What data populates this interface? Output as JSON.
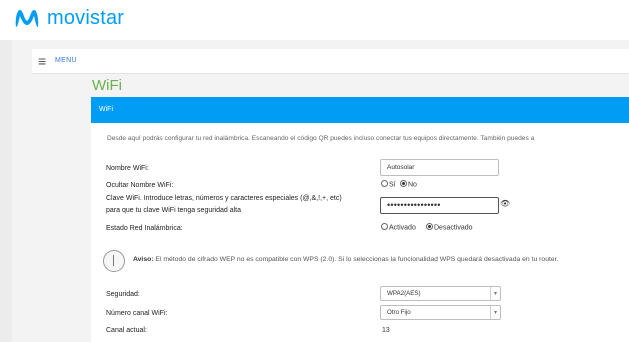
{
  "brand": {
    "name": "movistar",
    "color": "#019df4"
  },
  "menu": {
    "label": "MENU"
  },
  "page": {
    "title": "WiFi"
  },
  "panel": {
    "header": "WiFi",
    "description": "Desde aquí podrás configurar tu red inalámbrica. Escaneando el código QR puedes incluso conectar tus equipos directamente. También puedes a"
  },
  "form": {
    "network_name": {
      "label": "Nombre WiFi:",
      "value": "Autosolar"
    },
    "hide_name": {
      "label": "Ocultar Nombre WiFi:",
      "options": [
        "Sí",
        "No"
      ],
      "selected": "No"
    },
    "password": {
      "label": "Clave WiFi. Introduce letras, números y caracteres especiales (@,&,!,+, etc) para que tu clave WiFi tenga seguridad alta",
      "value": "••••••••••••••••"
    },
    "wireless_state": {
      "label": "Estado Red Inalámbrica:",
      "options": [
        "Activado",
        "Desactivado"
      ],
      "selected": "Desactivado"
    }
  },
  "warning": {
    "title": "Aviso:",
    "text": " El método de cifrado WEP no es compatible con WPS (2.0). Si lo seleccionas la funcionalidad WPS quedará desactivada en tu router."
  },
  "security": {
    "label": "Seguridad:",
    "value": "WPA2(AES)"
  },
  "channel": {
    "label": "Número canal WiFi:",
    "value": "Otro Fijo"
  },
  "current_channel": {
    "label": "Canal actual:",
    "value": "13"
  }
}
